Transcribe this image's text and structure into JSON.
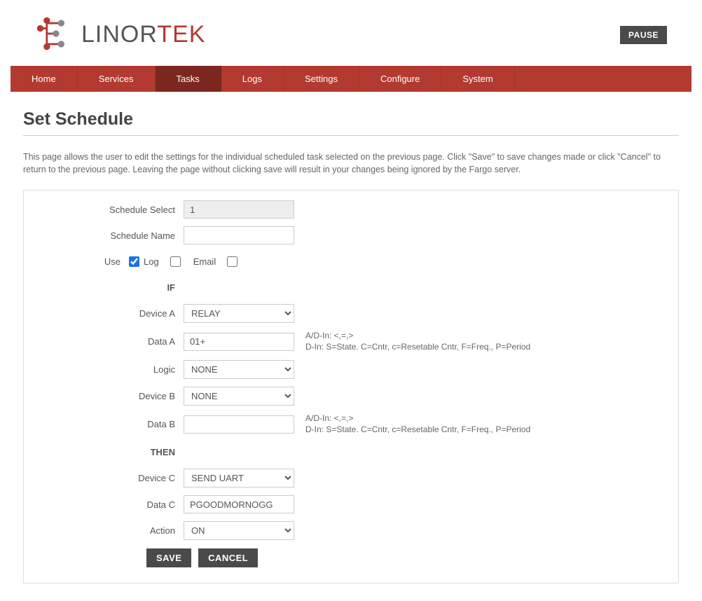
{
  "header": {
    "brand_prefix": "LINOR",
    "brand_suffix": "TEK",
    "pause_label": "PAUSE"
  },
  "nav": {
    "items": [
      {
        "label": "Home"
      },
      {
        "label": "Services"
      },
      {
        "label": "Tasks"
      },
      {
        "label": "Logs"
      },
      {
        "label": "Settings"
      },
      {
        "label": "Configure"
      },
      {
        "label": "System"
      }
    ],
    "active_index": 2
  },
  "page": {
    "title": "Set Schedule",
    "intro": "This page allows the user to edit the settings for the individual scheduled task selected on the previous page. Click \"Save\" to save changes made or click \"Cancel\" to return to the previous page. Leaving the page without clicking save will result in your changes being ignored by the Fargo server."
  },
  "form": {
    "labels": {
      "schedule_select": "Schedule Select",
      "schedule_name": "Schedule Name",
      "use": "Use",
      "log": "Log",
      "email": "Email",
      "if": "IF",
      "device_a": "Device A",
      "data_a": "Data A",
      "logic": "Logic",
      "device_b": "Device B",
      "data_b": "Data B",
      "then": "THEN",
      "device_c": "Device C",
      "data_c": "Data C",
      "action": "Action",
      "save": "SAVE",
      "cancel": "CANCEL"
    },
    "values": {
      "schedule_select": "1",
      "schedule_name": "",
      "use": true,
      "log": false,
      "email": false,
      "device_a": "RELAY",
      "data_a": "01+",
      "logic": "NONE",
      "device_b": "NONE",
      "data_b": "",
      "device_c": "SEND UART",
      "data_c": "PGOODMORNOGG",
      "action": "ON"
    },
    "hint_ad": "A/D-In: <,=,>",
    "hint_din": "D-In: S=State. C=Cntr, c=Resetable Cntr, F=Freq., P=Period"
  }
}
